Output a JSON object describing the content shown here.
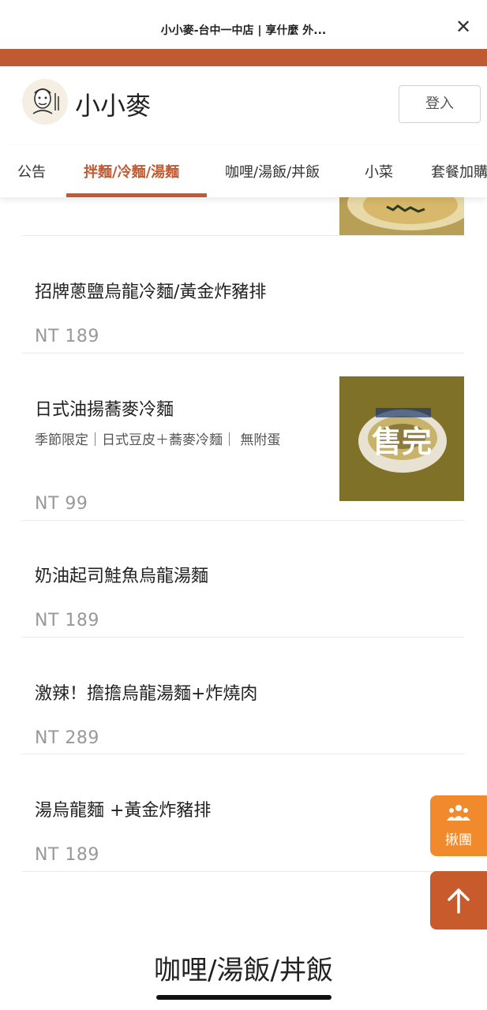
{
  "browser": {
    "title": "小小麥-台中一中店 | 享什麼 外...",
    "close_icon": "close-icon"
  },
  "header": {
    "brand": "小小麥",
    "login_label": "登入",
    "logo_icon": "chef-logo-icon"
  },
  "colors": {
    "accent": "#bf5a32",
    "float_orange": "#f08a2c",
    "float_top": "#c85b2b"
  },
  "tabs": [
    {
      "label": "公告"
    },
    {
      "label": "拌麵/冷麵/湯麵",
      "active": true
    },
    {
      "label": "咖哩/湯飯/丼飯"
    },
    {
      "label": "小菜"
    },
    {
      "label": "套餐加購"
    }
  ],
  "items": [
    {
      "name": "招牌蔥鹽烏龍冷麵/黃金炸豬排",
      "price": "NT 189"
    },
    {
      "name": "日式油揚蕎麥冷麵",
      "desc": "季節限定｜日式豆皮＋蕎麥冷麵｜ 無附蛋",
      "price": "NT 99",
      "badge": "售完"
    },
    {
      "name": "奶油起司鮭魚烏龍湯麵",
      "price": "NT 189"
    },
    {
      "name": "激辣！擔擔烏龍湯麵+炸燒肉",
      "price": "NT 289"
    },
    {
      "name": "湯烏龍麵 +黃金炸豬排",
      "price": "NT 189"
    }
  ],
  "float": {
    "group_label": "揪團",
    "group_icon": "people-icon",
    "top_icon": "arrow-up-icon"
  },
  "bottom": {
    "section_title": "咖哩/湯飯/丼飯"
  }
}
